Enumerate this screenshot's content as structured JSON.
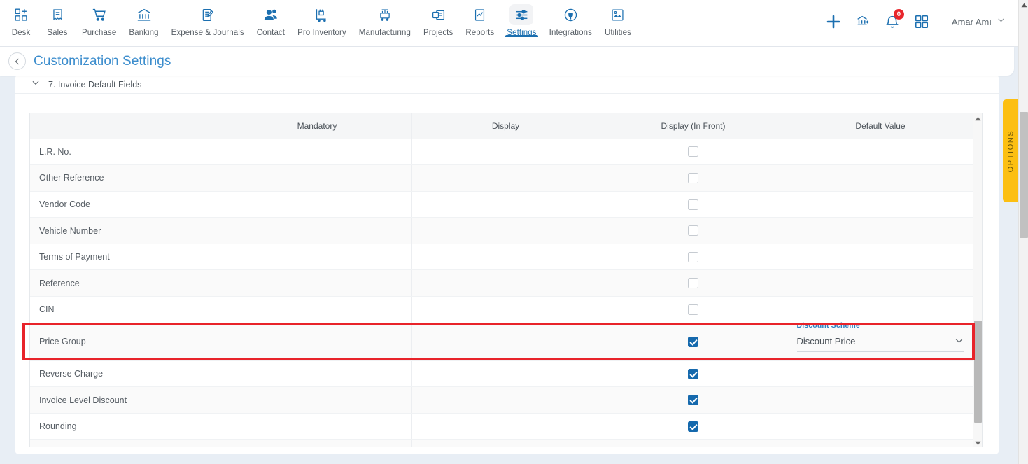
{
  "nav": {
    "items": [
      {
        "label": "Desk",
        "icon": "desk-grid-plus-icon",
        "active": false
      },
      {
        "label": "Sales",
        "icon": "receipt-icon",
        "active": false
      },
      {
        "label": "Purchase",
        "icon": "cart-icon",
        "active": false
      },
      {
        "label": "Banking",
        "icon": "bank-icon",
        "active": false
      },
      {
        "label": "Expense & Journals",
        "icon": "journal-pen-icon",
        "active": false
      },
      {
        "label": "Contact",
        "icon": "people-icon",
        "active": false
      },
      {
        "label": "Pro Inventory",
        "icon": "inventory-trolley-icon",
        "active": false
      },
      {
        "label": "Manufacturing",
        "icon": "manufacturing-icon",
        "active": false
      },
      {
        "label": "Projects",
        "icon": "projects-briefcase-icon",
        "active": false
      },
      {
        "label": "Reports",
        "icon": "report-chart-icon",
        "active": false
      },
      {
        "label": "Settings",
        "icon": "sliders-icon",
        "active": true
      },
      {
        "label": "Integrations",
        "icon": "plug-icon",
        "active": false
      },
      {
        "label": "Utilities",
        "icon": "utilities-icon",
        "active": false
      }
    ],
    "right": {
      "add_icon": "plus-icon",
      "transfer_icon": "bank-transfer-icon",
      "notifications_icon": "bell-icon",
      "notifications_count": "0",
      "apps_icon": "grid-apps-icon",
      "user_name": "Amar Amı",
      "user_chevron_icon": "chevron-down-icon"
    }
  },
  "header": {
    "back_icon": "chevron-left-icon",
    "title": "Customization Settings"
  },
  "section": {
    "collapse_icon": "chevron-down-icon",
    "title": "7. Invoice Default Fields"
  },
  "table": {
    "columns": [
      "",
      "Mandatory",
      "Display",
      "Display (In Front)",
      "Default Value"
    ],
    "rows": [
      {
        "name": "L.R. No.",
        "mandatory": null,
        "display": null,
        "in_front": false,
        "default_value": null
      },
      {
        "name": "Other Reference",
        "mandatory": null,
        "display": null,
        "in_front": false,
        "default_value": null
      },
      {
        "name": "Vendor Code",
        "mandatory": null,
        "display": null,
        "in_front": false,
        "default_value": null
      },
      {
        "name": "Vehicle Number",
        "mandatory": null,
        "display": null,
        "in_front": false,
        "default_value": null
      },
      {
        "name": "Terms of Payment",
        "mandatory": null,
        "display": null,
        "in_front": false,
        "default_value": null
      },
      {
        "name": "Reference",
        "mandatory": null,
        "display": null,
        "in_front": false,
        "default_value": null
      },
      {
        "name": "CIN",
        "mandatory": null,
        "display": null,
        "in_front": false,
        "default_value": null
      },
      {
        "name": "Price Group",
        "mandatory": null,
        "display": null,
        "in_front": true,
        "default_value": {
          "label": "Discount Scheme",
          "value": "Discount Price"
        }
      },
      {
        "name": "Reverse Charge",
        "mandatory": null,
        "display": null,
        "in_front": true,
        "default_value": null
      },
      {
        "name": "Invoice Level Discount",
        "mandatory": null,
        "display": null,
        "in_front": true,
        "default_value": null
      },
      {
        "name": "Rounding",
        "mandatory": null,
        "display": null,
        "in_front": true,
        "default_value": null
      },
      {
        "name": "",
        "mandatory": null,
        "display": null,
        "in_front": false,
        "default_value": null
      }
    ],
    "highlighted_row": "Price Group"
  },
  "options_tab": {
    "label": "OPTIONS",
    "color": "#fcbf12"
  },
  "colors": {
    "accent_blue": "#1b6fb0",
    "title_blue": "#3c8dcd",
    "checkbox_blue": "#1569ad",
    "highlight_red": "#e8232a",
    "options_yellow": "#fcbf12",
    "badge_red": "#e8262c"
  }
}
